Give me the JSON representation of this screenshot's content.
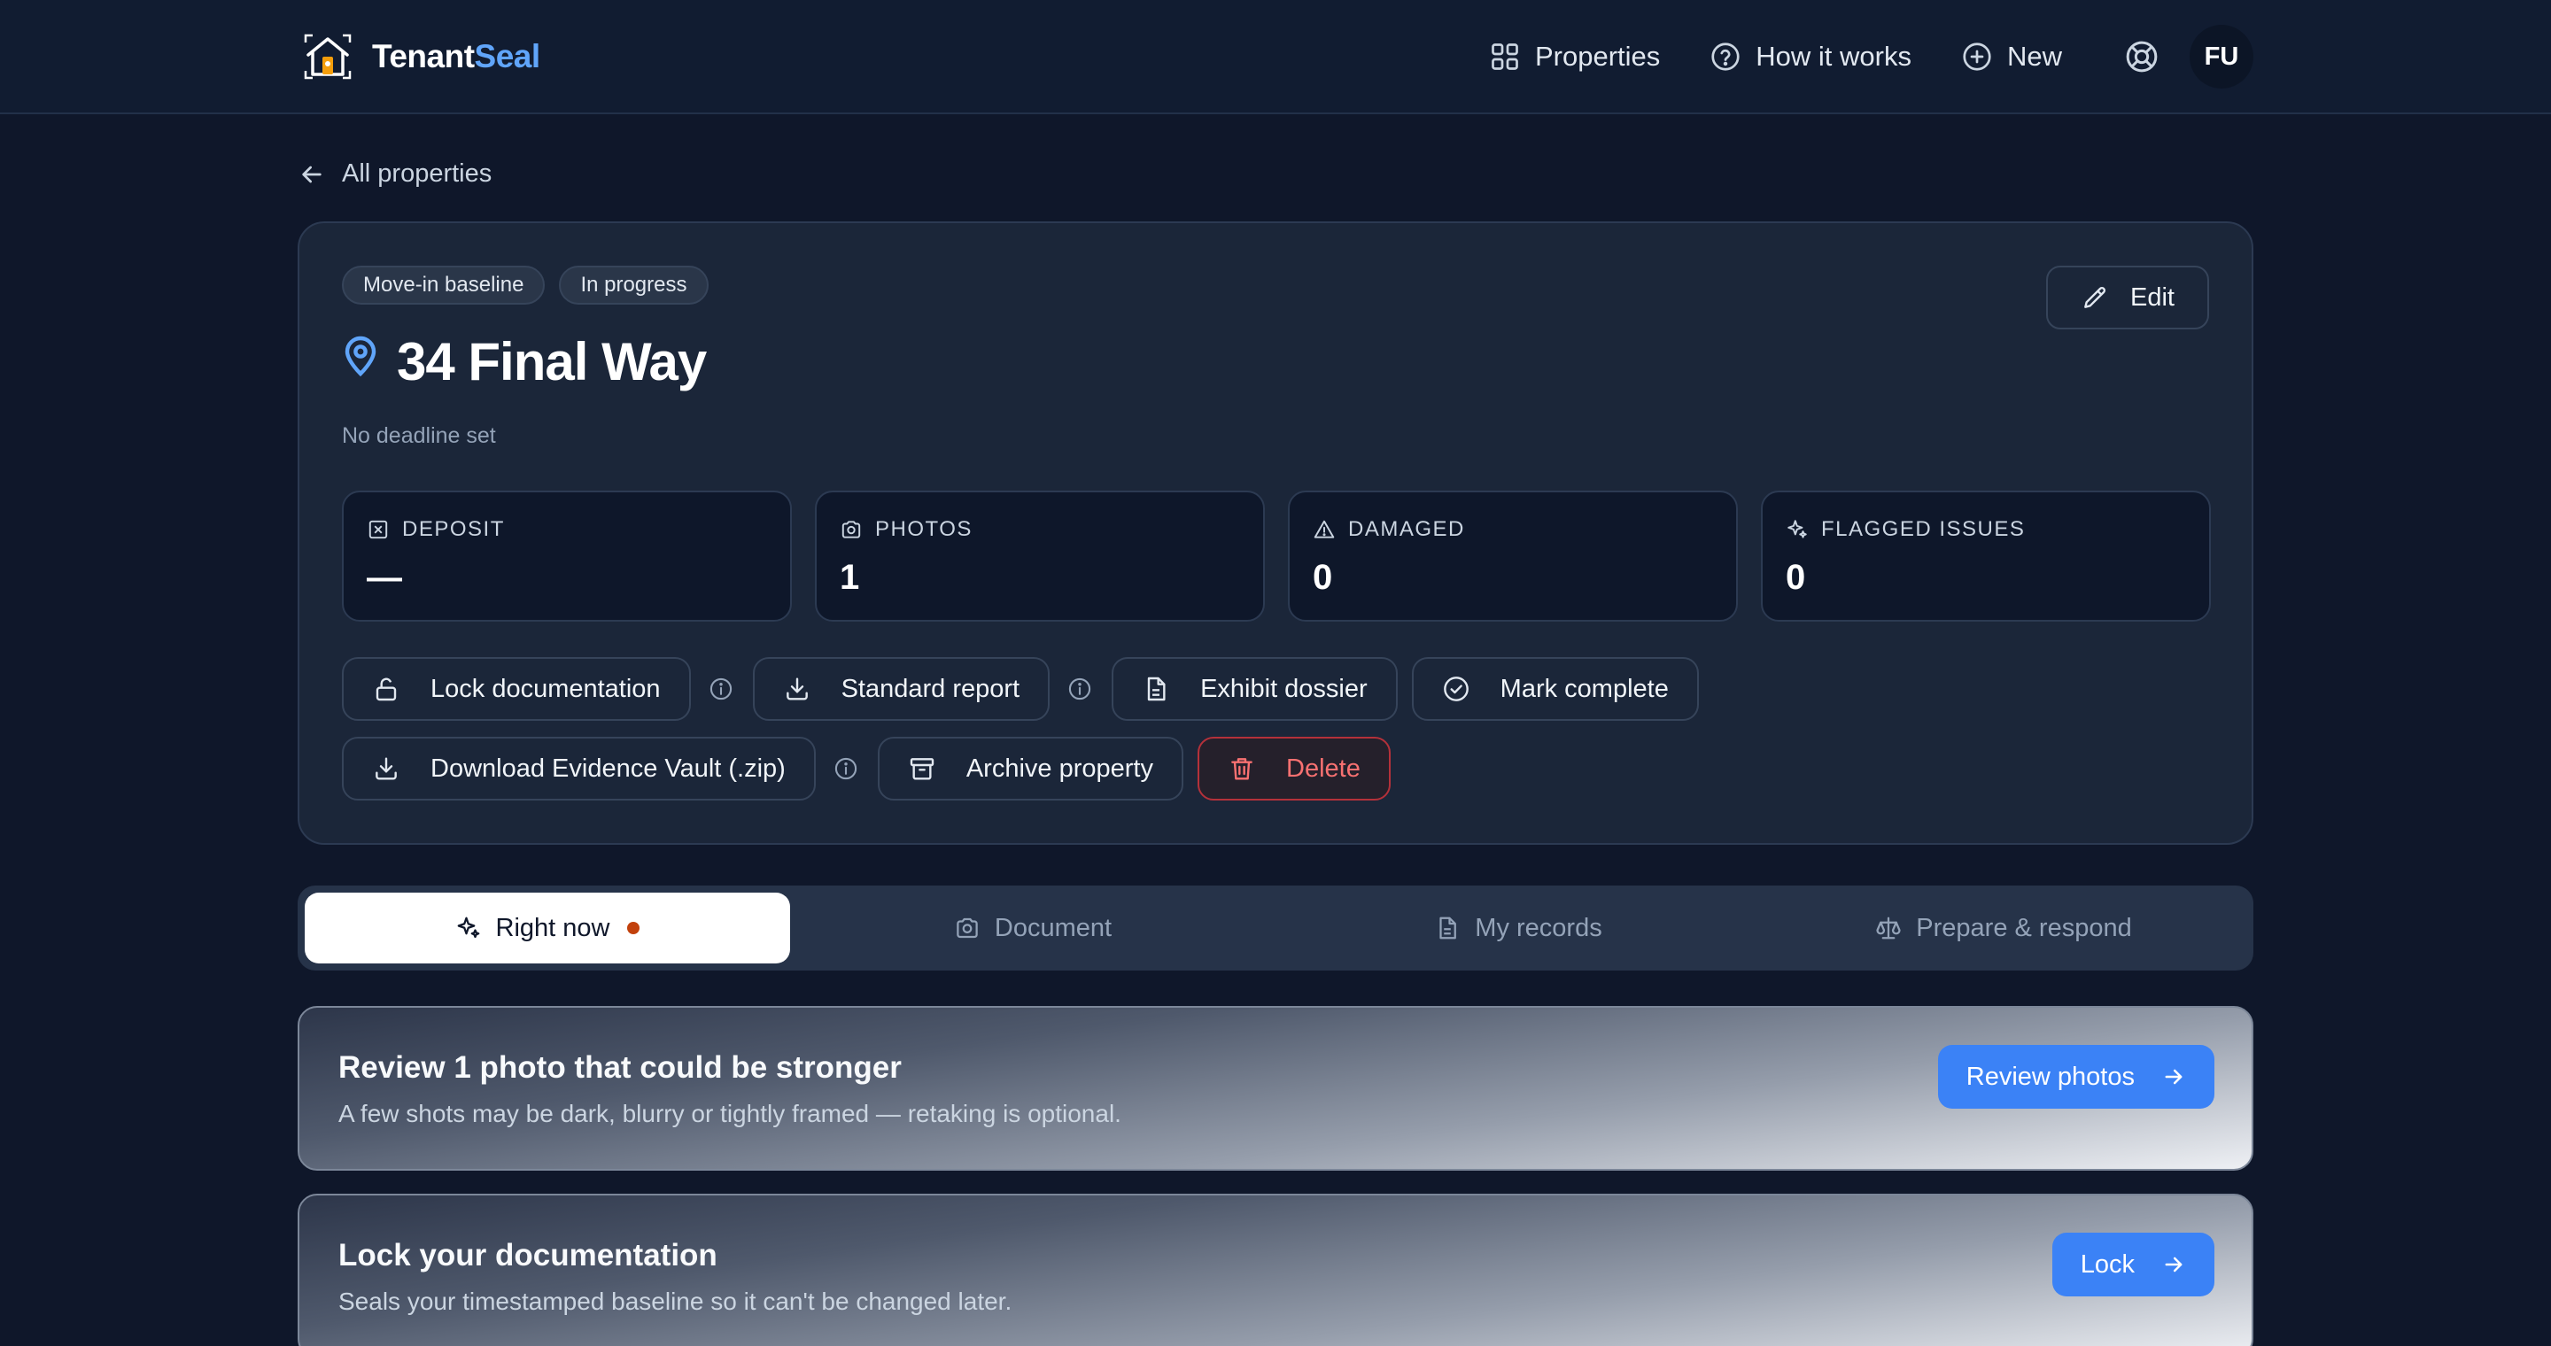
{
  "header": {
    "brand_part1": "Tenant",
    "brand_part2": "Seal",
    "nav": [
      {
        "label": "Properties",
        "icon": "grid-icon"
      },
      {
        "label": "How it works",
        "icon": "help-circle-icon"
      },
      {
        "label": "New",
        "icon": "plus-circle-icon"
      }
    ],
    "avatar_initials": "FU"
  },
  "back_link": "All properties",
  "property": {
    "badges": [
      "Move-in baseline",
      "In progress"
    ],
    "title": "34 Final Way",
    "deadline": "No deadline set",
    "edit_label": "Edit",
    "stats": [
      {
        "label": "DEPOSIT",
        "value": "—",
        "icon": "deposit-icon"
      },
      {
        "label": "PHOTOS",
        "value": "1",
        "icon": "camera-icon"
      },
      {
        "label": "DAMAGED",
        "value": "0",
        "icon": "warning-icon"
      },
      {
        "label": "FLAGGED ISSUES",
        "value": "0",
        "icon": "sparkle-icon"
      }
    ],
    "actions": {
      "lock": "Lock documentation",
      "standard_report": "Standard report",
      "exhibit_dossier": "Exhibit dossier",
      "mark_complete": "Mark complete",
      "download_vault": "Download Evidence Vault (.zip)",
      "archive": "Archive property",
      "delete": "Delete"
    }
  },
  "tabs": [
    {
      "label": "Right now",
      "active": true
    },
    {
      "label": "Document",
      "active": false
    },
    {
      "label": "My records",
      "active": false
    },
    {
      "label": "Prepare & respond",
      "active": false
    }
  ],
  "tasks": [
    {
      "title": "Review 1 photo that could be stronger",
      "subtitle": "A few shots may be dark, blurry or tightly framed — retaking is optional.",
      "button": "Review photos"
    },
    {
      "title": "Lock your documentation",
      "subtitle": "Seals your timestamped baseline so it can't be changed later.",
      "button": "Lock"
    }
  ],
  "colors": {
    "background": "#0f172a",
    "card": "#1b2639",
    "accent": "#3b82f6",
    "brand_accent": "#60a5fa",
    "danger": "#f87171",
    "notification_dot": "#c2410c"
  }
}
